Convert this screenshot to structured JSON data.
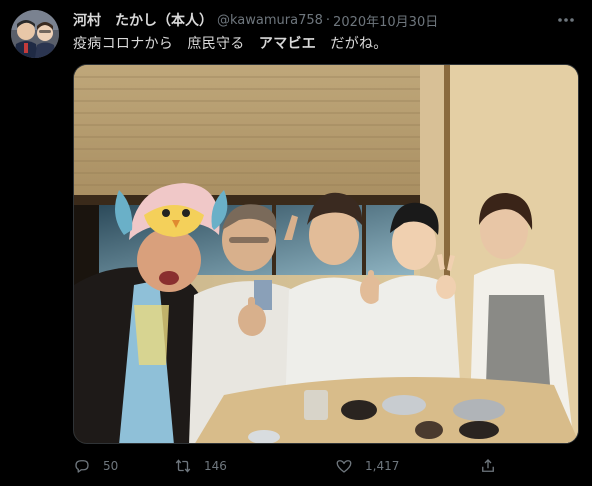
{
  "tweet": {
    "display_name": "河村　たかし（本人）",
    "handle": "@kawamura758",
    "separator": "·",
    "date": "2020年10月30日",
    "text": "疫病コロナから　庶民守る　アマビエ　だがね。",
    "text_parts": {
      "before": "疫病コロナから　庶民守る　",
      "bold": "アマビエ",
      "after": "　だがね。"
    }
  },
  "actions": {
    "replies": "50",
    "retweets": "146",
    "likes": "1,417"
  },
  "icons": {
    "more": "more-icon",
    "reply": "reply-icon",
    "retweet": "retweet-icon",
    "like": "heart-icon",
    "share": "share-icon"
  },
  "colors": {
    "background": "#000000",
    "text": "#d9d9d9",
    "muted": "#6e767d"
  }
}
